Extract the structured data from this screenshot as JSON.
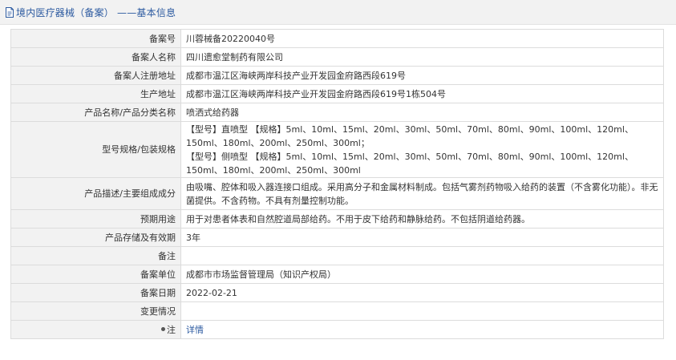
{
  "header": {
    "title": "境内医疗器械（备案） ——基本信息"
  },
  "rows": {
    "record_no": {
      "label": "备案号",
      "value": "川蓉械备20220040号"
    },
    "registrant": {
      "label": "备案人名称",
      "value": "四川遗愈堂制药有限公司"
    },
    "reg_address": {
      "label": "备案人注册地址",
      "value": "成都市温江区海峡两岸科技产业开发园金府路西段619号"
    },
    "prod_address": {
      "label": "生产地址",
      "value": "成都市温江区海峡两岸科技产业开发园金府路西段619号1栋504号"
    },
    "product_name": {
      "label": "产品名称/产品分类名称",
      "value": "喷洒式给药器"
    },
    "spec": {
      "label": "型号规格/包装规格",
      "line1": "【型号】直喷型 【规格】5ml、10ml、15ml、20ml、30ml、50ml、70ml、80ml、90ml、100ml、120ml、150ml、180ml、200ml、250ml、300ml；",
      "line2": "【型号】侧喷型 【规格】5ml、10ml、15ml、20ml、30ml、50ml、70ml、80ml、90ml、100ml、120ml、150ml、180ml、200ml、250ml、300ml"
    },
    "description": {
      "label": "产品描述/主要组成成分",
      "value": "由吸嘴、腔体和吸入器连接口组成。采用高分子和金属材料制成。包括气雾剂药物吸入给药的装置（不含雾化功能）。非无菌提供。不含药物。不具有剂量控制功能。"
    },
    "intended_use": {
      "label": "预期用途",
      "value": "用于对患者体表和自然腔道局部给药。不用于皮下给药和静脉给药。不包括阴道给药器。"
    },
    "storage": {
      "label": "产品存储及有效期",
      "value": "3年"
    },
    "remark": {
      "label": "备注",
      "value": ""
    },
    "agency": {
      "label": "备案单位",
      "value": "成都市市场监督管理局（知识产权局）"
    },
    "date": {
      "label": "备案日期",
      "value": "2022-02-21"
    },
    "change": {
      "label": "变更情况",
      "value": ""
    },
    "note": {
      "label": "注",
      "link": "详情"
    }
  },
  "colors": {
    "accent": "#2c5aa0",
    "label_bg": "#f2f2f2",
    "border": "#dcdcdc"
  }
}
